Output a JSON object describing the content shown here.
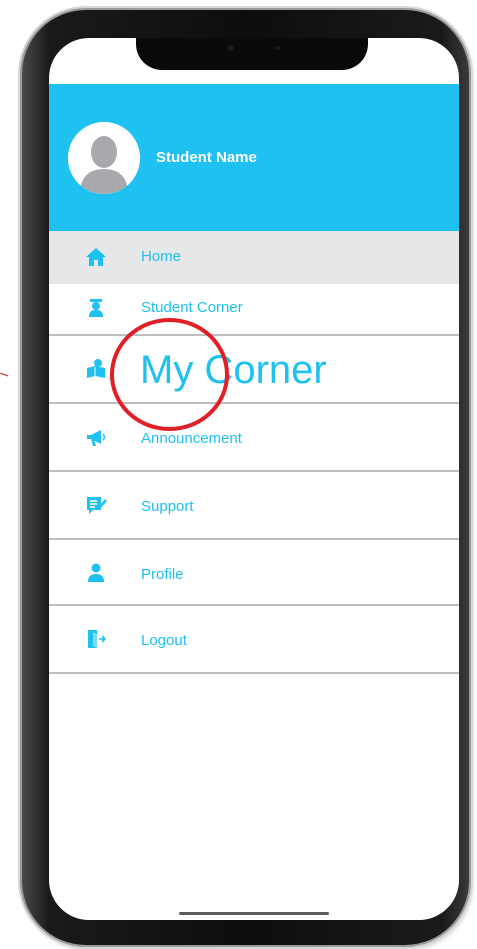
{
  "profile": {
    "student_name": "Student Name"
  },
  "menu": {
    "items": [
      {
        "label": "Home",
        "icon": "home-icon",
        "active": true
      },
      {
        "label": "Student Corner",
        "icon": "graduate-icon",
        "active": false
      },
      {
        "label": "My Corner",
        "icon": "reader-icon",
        "active": false
      },
      {
        "label": "Announcement",
        "icon": "megaphone-icon",
        "active": false
      },
      {
        "label": "Support",
        "icon": "support-icon",
        "active": false
      },
      {
        "label": "Profile",
        "icon": "profile-icon",
        "active": false
      },
      {
        "label": "Logout",
        "icon": "logout-icon",
        "active": false
      }
    ]
  },
  "colors": {
    "accent": "#1ec1ef",
    "active_row": "#e6e7e8",
    "annotation": "#e01f26",
    "divider": "#bdbdbd"
  }
}
